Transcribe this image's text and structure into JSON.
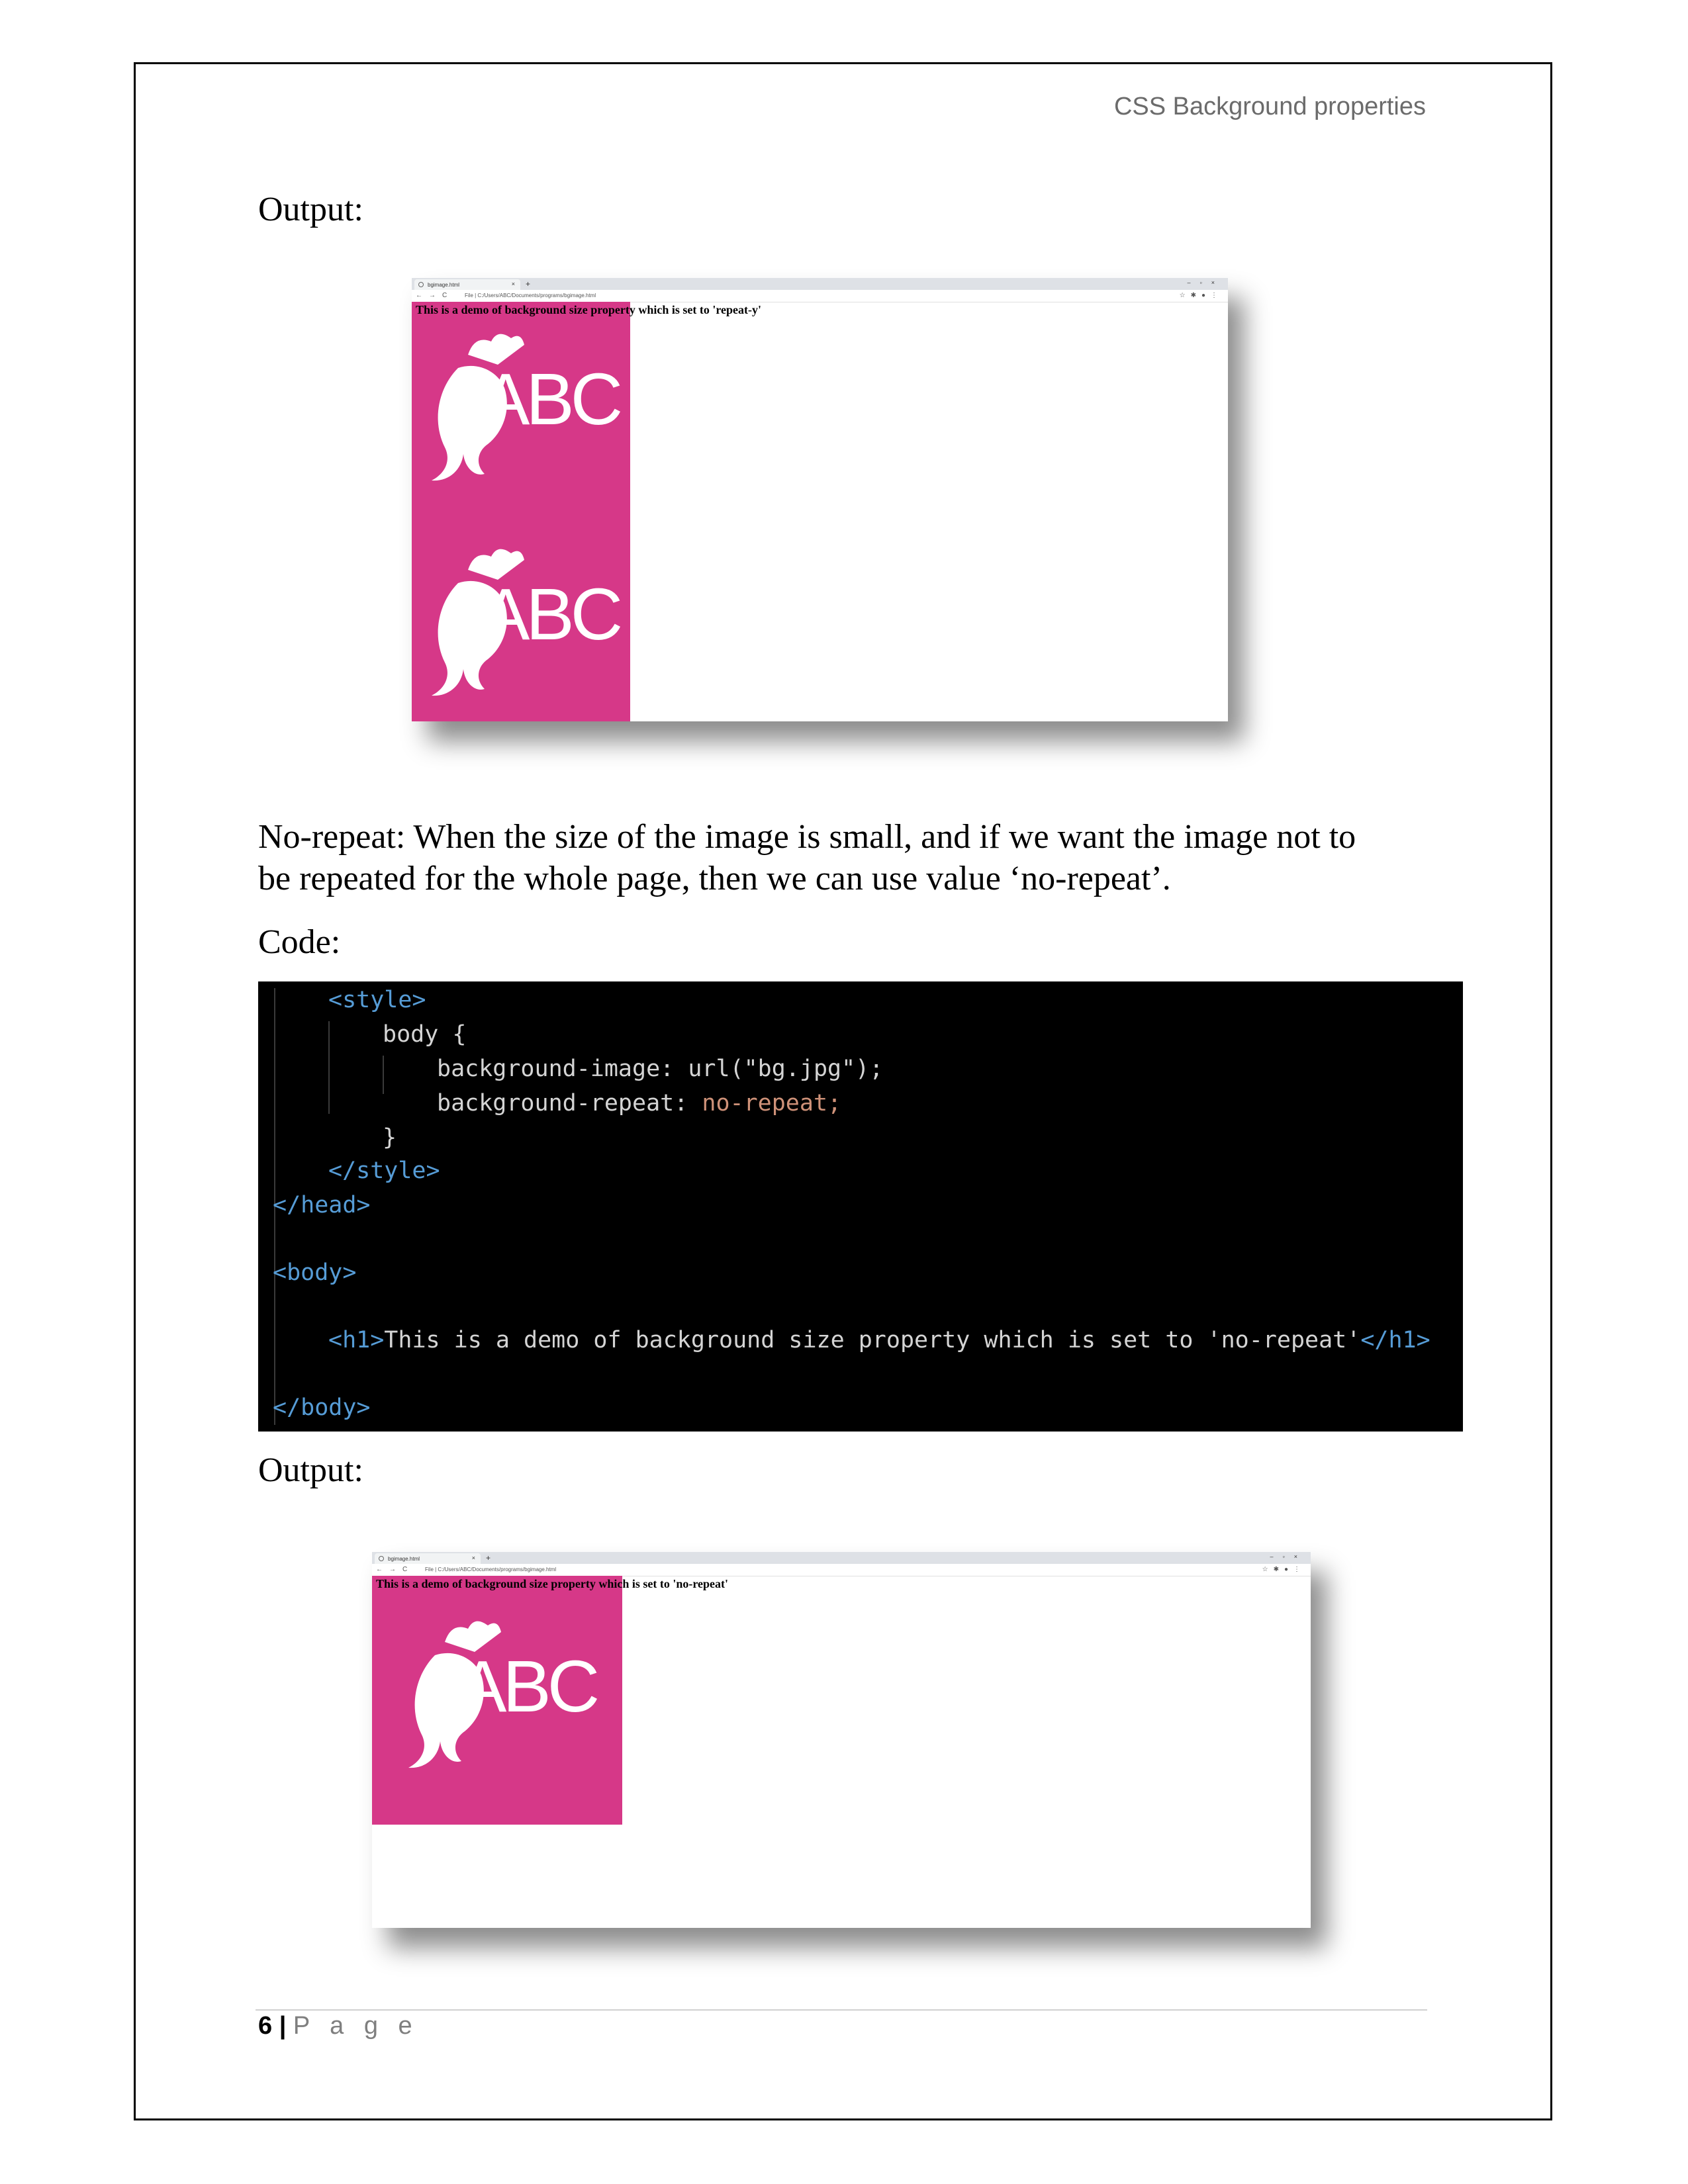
{
  "header": {
    "title": "CSS Background properties"
  },
  "section1": {
    "output_label": "Output:"
  },
  "browser1": {
    "tab_title": "bgimage.html",
    "url": "C:/Users/ABC/Documents/programs/bgimage.html",
    "file_label": "File",
    "heading": "This is a demo of background size property which is set to 'repeat-y'",
    "logo_text": "ABC"
  },
  "section2": {
    "para_line1": "No-repeat: When the size of the image is small, and if we want the image not to",
    "para_line2": "be repeated for the whole page, then we can use value ‘no-repeat’.",
    "code_label": "Code:",
    "output_label": "Output:"
  },
  "code": {
    "style_open": "<style>",
    "selector": "body",
    "open_brace": "{",
    "line_bg_image_prop": "background-image:",
    "line_bg_image_val": "url(\"bg.jpg\");",
    "line_bg_repeat_prop": "background-repeat:",
    "line_bg_repeat_val": "no-repeat;",
    "close_brace": "}",
    "style_close": "</style>",
    "head_close": "</head>",
    "body_open": "<body>",
    "h1_open": "<h1>",
    "h1_text": "This is a demo of background size property which is set to 'no-repeat'",
    "h1_close": "</h1>",
    "body_close": "</body>"
  },
  "browser2": {
    "tab_title": "bgimage.html",
    "url": "C:/Users/ABC/Documents/programs/bgimage.html",
    "file_label": "File",
    "heading": "This is a demo of background size property which is set to 'no-repeat'",
    "logo_text": "ABC"
  },
  "footer": {
    "page_number": "6",
    "separator": "|",
    "page_word": "P a g e"
  },
  "colors": {
    "logo_bg": "#d63888",
    "code_bg": "#000000"
  }
}
